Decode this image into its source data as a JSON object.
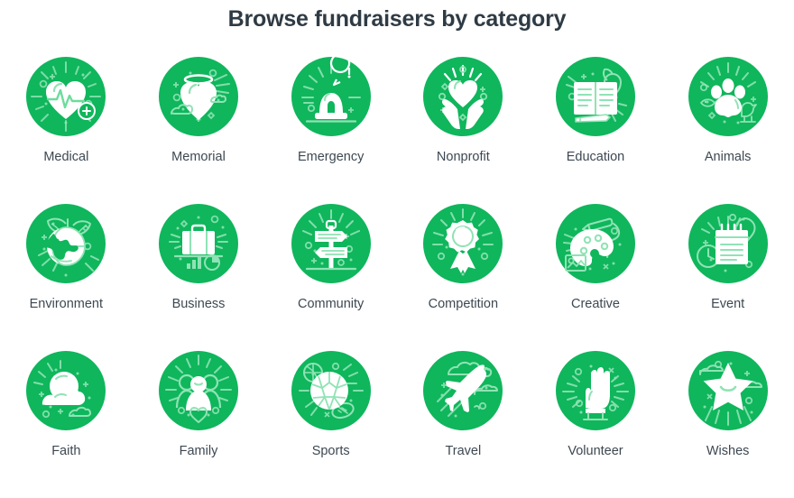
{
  "header": {
    "title": "Browse fundraisers by category"
  },
  "theme": {
    "background": "#ffffff",
    "circle_green": "#0fb65c",
    "icon_white": "#ffffff",
    "icon_accent": "#8fe3b4",
    "title_color": "#2f3b44",
    "label_color": "#3d4852"
  },
  "grid": {
    "columns": 6,
    "rows": 3,
    "categories": [
      {
        "label": "Medical",
        "icon": "heart-pulse-icon"
      },
      {
        "label": "Memorial",
        "icon": "heart-halo-icon"
      },
      {
        "label": "Emergency",
        "icon": "siren-light-icon"
      },
      {
        "label": "Nonprofit",
        "icon": "hands-heart-icon"
      },
      {
        "label": "Education",
        "icon": "open-book-icon"
      },
      {
        "label": "Animals",
        "icon": "paw-print-icon"
      },
      {
        "label": "Environment",
        "icon": "globe-leaves-icon"
      },
      {
        "label": "Business",
        "icon": "briefcase-chart-icon"
      },
      {
        "label": "Community",
        "icon": "signpost-icon"
      },
      {
        "label": "Competition",
        "icon": "award-ribbon-icon"
      },
      {
        "label": "Creative",
        "icon": "paint-palette-icon"
      },
      {
        "label": "Event",
        "icon": "calendar-balloon-icon"
      },
      {
        "label": "Faith",
        "icon": "sun-clouds-icon"
      },
      {
        "label": "Family",
        "icon": "family-group-icon"
      },
      {
        "label": "Sports",
        "icon": "soccer-ball-icon"
      },
      {
        "label": "Travel",
        "icon": "airplane-icon"
      },
      {
        "label": "Volunteer",
        "icon": "raised-hand-icon"
      },
      {
        "label": "Wishes",
        "icon": "smiling-star-icon"
      }
    ]
  }
}
